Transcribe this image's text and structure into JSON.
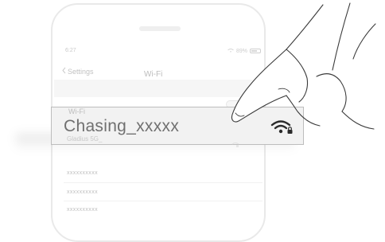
{
  "status_bar": {
    "time": "6:27",
    "battery": "89%"
  },
  "nav": {
    "back_label": "Settings",
    "title": "Wi-Fi"
  },
  "highlight": {
    "section_label": "Wi-Fi",
    "ssid": "Chasing_xxxxx",
    "sub_label": "Gladius 5G_"
  },
  "networks": [
    {
      "name": "xxxxxxxxxx"
    },
    {
      "name": "xxxxxxxxxx"
    },
    {
      "name": "xxxxxxxxxx"
    }
  ],
  "colors": {
    "highlight_bg": "#f2f2f2",
    "highlight_border": "#bdbdbd",
    "ssid_text": "#707070"
  },
  "icons": [
    "wifi-lock-icon",
    "signal-icon",
    "battery-icon",
    "back-chevron-icon"
  ]
}
